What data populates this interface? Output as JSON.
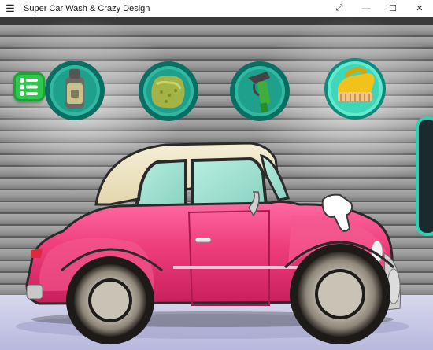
{
  "window": {
    "title": "Super Car Wash & Crazy Design",
    "menu_icon": "hamburger-icon",
    "controls": [
      {
        "name": "fullscreen-icon",
        "glyph": "⤢"
      },
      {
        "name": "minimize-icon",
        "glyph": "—"
      },
      {
        "name": "maximize-icon",
        "glyph": "☐"
      },
      {
        "name": "close-icon",
        "glyph": "✕"
      }
    ]
  },
  "game": {
    "menu_button_icon": "list-icon",
    "tools": [
      {
        "name": "shampoo-bottle",
        "selected": false
      },
      {
        "name": "sponge",
        "selected": false
      },
      {
        "name": "water-hose",
        "selected": false
      },
      {
        "name": "scrub-brush",
        "selected": true
      }
    ],
    "car_color": "#f0407a",
    "roof_color": "#eee4c4",
    "cursor_icon": "pointing-hand-icon"
  },
  "colors": {
    "accent": "#2fd0b3",
    "tool_ring": "#0f8a7a",
    "menu_green": "#2ec84a",
    "wall": "#8f8f8f"
  }
}
